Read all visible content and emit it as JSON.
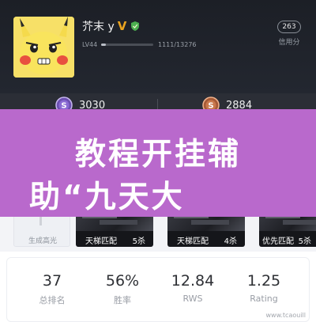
{
  "profile": {
    "name": "芥末 y",
    "vip_badge": "V",
    "level": "LV44",
    "xp": "1111/13276",
    "xp_progress": 0.0837,
    "credit_score": "263",
    "credit_label": "信用分"
  },
  "coins": {
    "left_value": "3030",
    "right_value": "2884"
  },
  "banner": {
    "line1": "教程开挂辅",
    "line2": "助“九天大"
  },
  "highlights": {
    "first_label": "生成高光",
    "cards": [
      {
        "mode": "天梯匹配",
        "kills": "5杀"
      },
      {
        "mode": "天梯匹配",
        "kills": "4杀"
      },
      {
        "mode": "优先匹配",
        "kills": "5杀"
      }
    ]
  },
  "stats": [
    {
      "value": "37",
      "label": "总排名"
    },
    {
      "value": "56%",
      "label": "胜率"
    },
    {
      "value": "12.84",
      "label": "RWS"
    },
    {
      "value": "1.25",
      "label": "Rating"
    }
  ],
  "watermark": "www.tcaouill"
}
